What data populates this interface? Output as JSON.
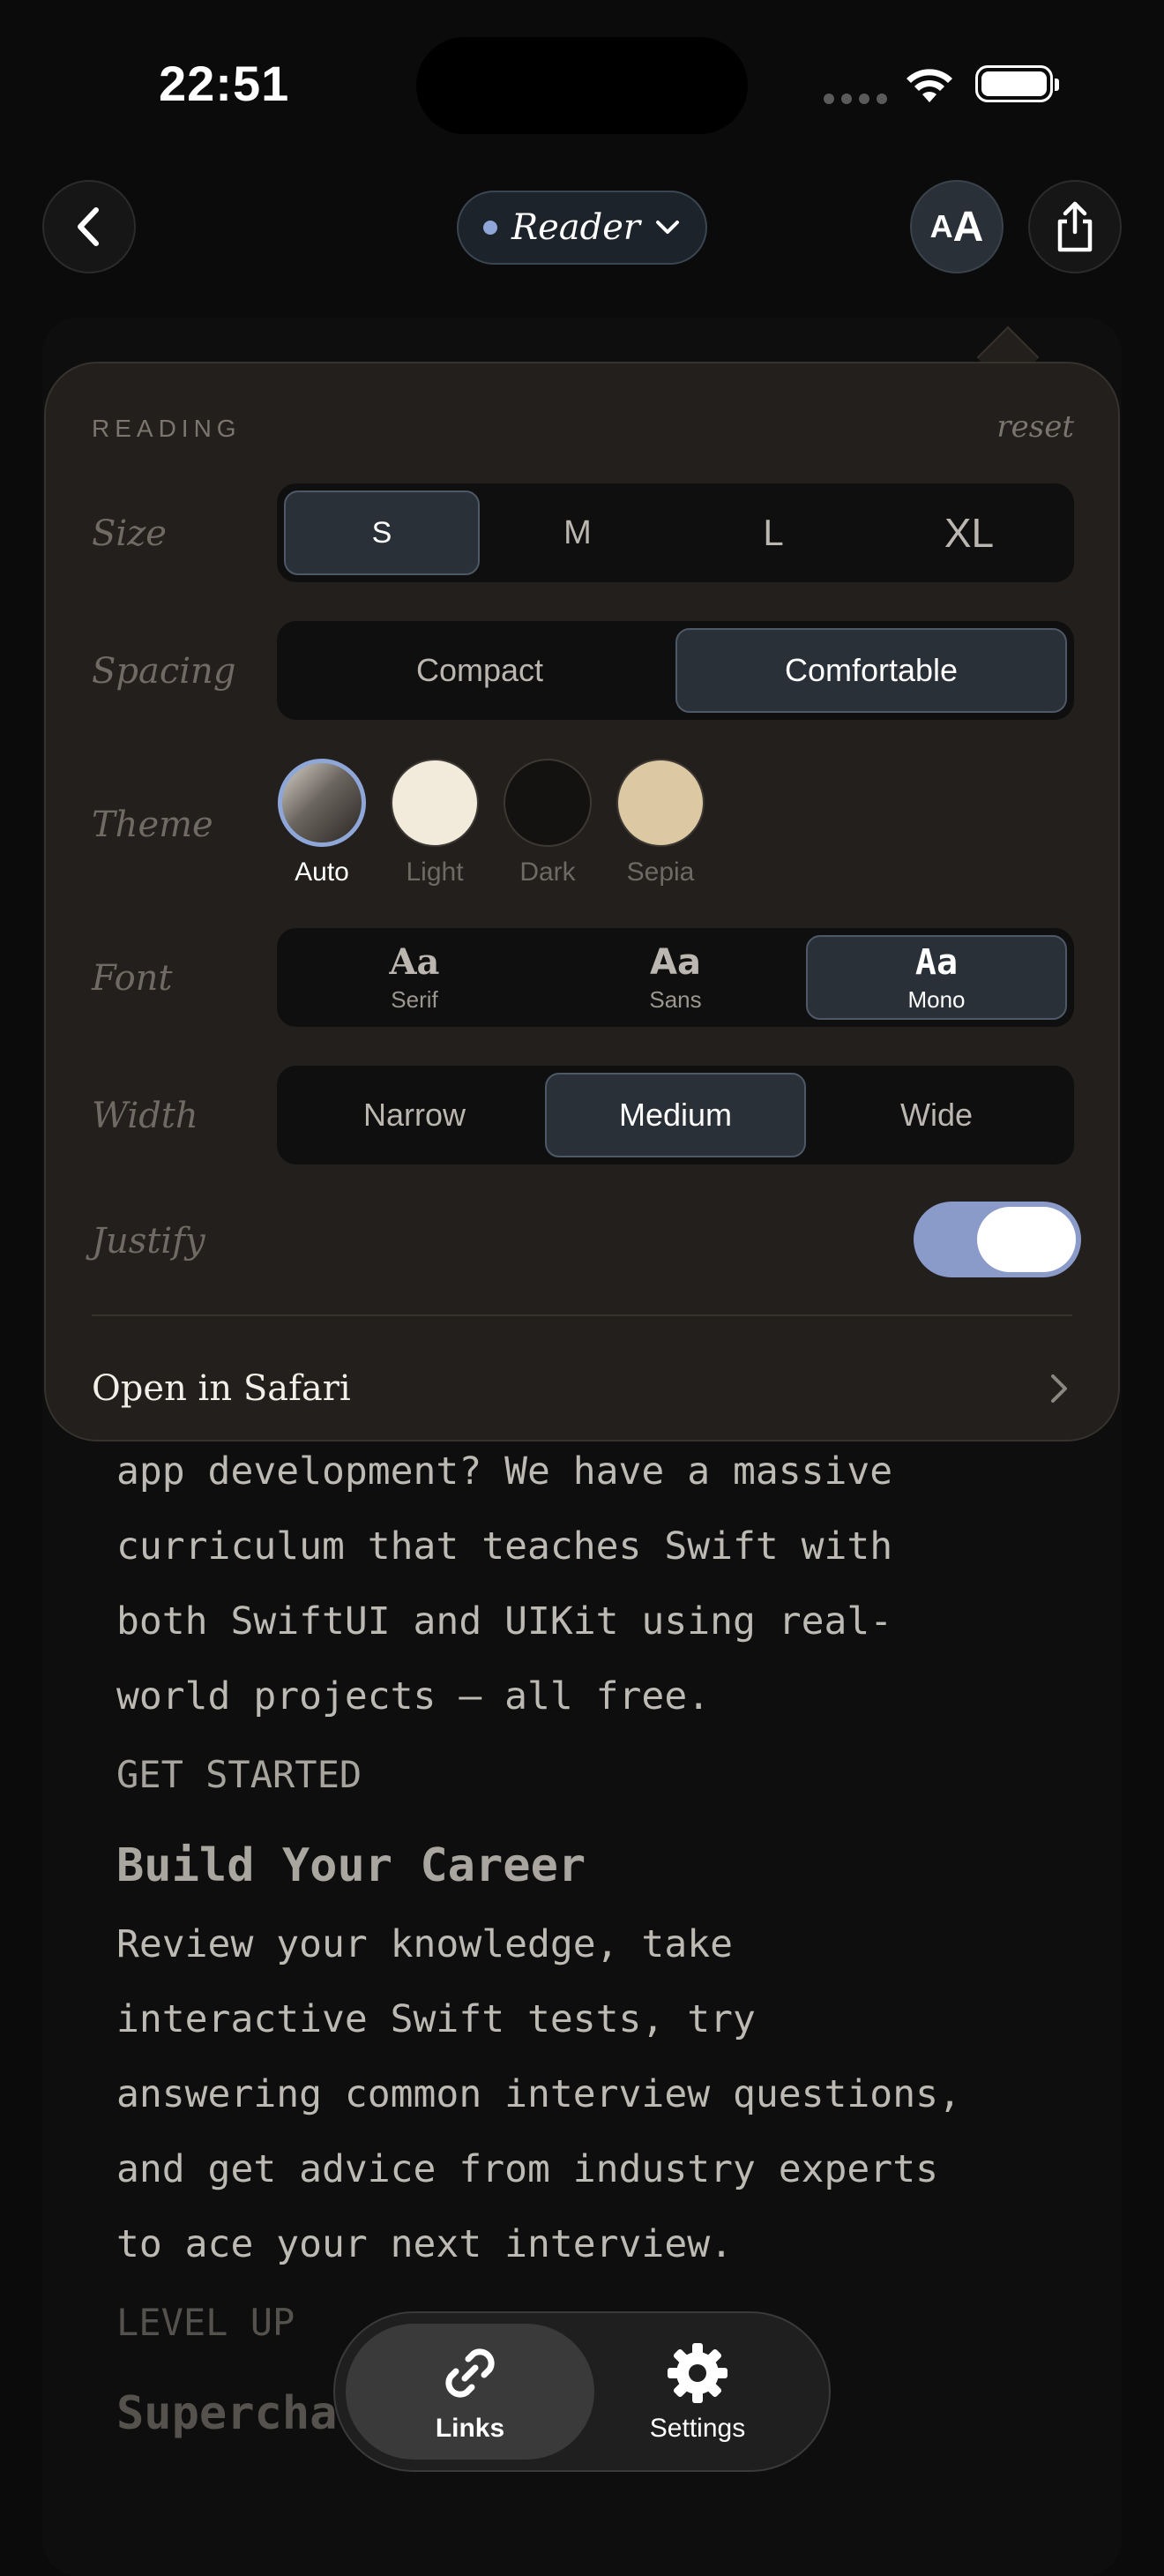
{
  "status_bar": {
    "time": "22:51"
  },
  "nav": {
    "mode_label": "Reader",
    "text_size_label_small": "A",
    "text_size_label_big": "A"
  },
  "reading": {
    "header": "READING",
    "reset": "reset",
    "size": {
      "label": "Size",
      "options": [
        "S",
        "M",
        "L",
        "XL"
      ],
      "selected": "S"
    },
    "spacing": {
      "label": "Spacing",
      "options": [
        "Compact",
        "Comfortable"
      ],
      "selected": "Comfortable"
    },
    "theme": {
      "label": "Theme",
      "options": [
        "Auto",
        "Light",
        "Dark",
        "Sepia"
      ],
      "selected": "Auto",
      "colors": {
        "light": "#f2ebdc",
        "dark": "#141210",
        "sepia": "#dcc8a2",
        "selected_ring": "#8fa6d8"
      }
    },
    "font": {
      "label": "Font",
      "options": [
        {
          "glyph": "Aa",
          "name": "Serif"
        },
        {
          "glyph": "Aa",
          "name": "Sans"
        },
        {
          "glyph": "Aa",
          "name": "Mono"
        }
      ],
      "selected": "Mono"
    },
    "width": {
      "label": "Width",
      "options": [
        "Narrow",
        "Medium",
        "Wide"
      ],
      "selected": "Medium"
    },
    "justify": {
      "label": "Justify",
      "enabled": true
    },
    "open_in_safari": "Open in Safari"
  },
  "article": {
    "lines_1": [
      "app development? We have a massive",
      "curriculum that teaches Swift with",
      "both SwiftUI and UIKit using real-",
      "world projects — all free."
    ],
    "cta_1": "GET STARTED",
    "heading_2": "Build Your Career",
    "lines_2": [
      "Review your knowledge, take",
      "interactive Swift tests, try",
      "answering common interview questions,",
      "and get advice from industry experts",
      "to ace your next interview."
    ],
    "cta_2": "LEVEL UP",
    "heading_3": "Supercharge your skills"
  },
  "tabbar": {
    "links": "Links",
    "settings": "Settings",
    "selected": "Links"
  }
}
